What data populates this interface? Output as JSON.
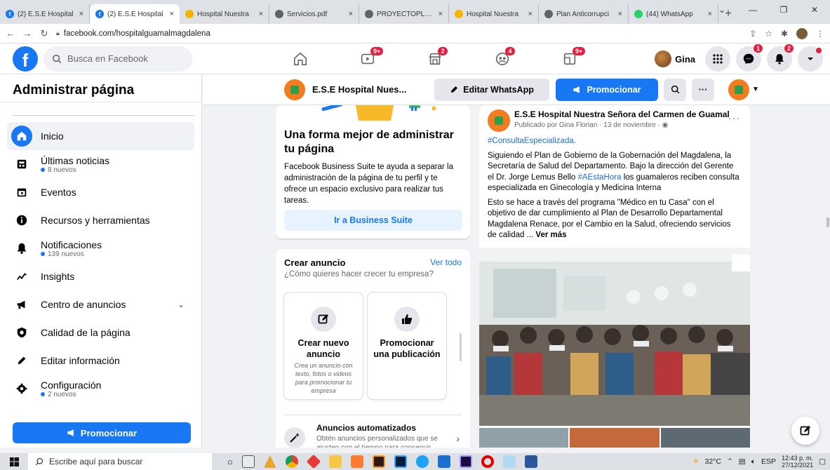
{
  "browser": {
    "tabs": [
      {
        "label": "(2) E.S.E Hospital",
        "color": "#1877f2",
        "active": false
      },
      {
        "label": "(2) E.S.E Hospital",
        "color": "#1877f2",
        "active": true
      },
      {
        "label": "Hospital Nuestra",
        "color": "#f4b400",
        "active": false
      },
      {
        "label": "Servicios.pdf",
        "color": "#5f6368",
        "active": false
      },
      {
        "label": "PROYECTOPLANE",
        "color": "#5f6368",
        "active": false
      },
      {
        "label": "Hospital Nuestra",
        "color": "#f4b400",
        "active": false
      },
      {
        "label": "Plan Anticorrupci",
        "color": "#5f6368",
        "active": false
      },
      {
        "label": "(44) WhatsApp",
        "color": "#25d366",
        "active": false
      }
    ],
    "close_glyph": "×",
    "newtab_glyph": "+",
    "url": "facebook.com/hospitalguamalmagdalena"
  },
  "fb_nav": {
    "logo_letter": "f",
    "search_placeholder": "Busca en Facebook",
    "icons": [
      {
        "name": "home-icon",
        "badge": ""
      },
      {
        "name": "watch-icon",
        "badge": "9+"
      },
      {
        "name": "marketplace-icon",
        "badge": "2"
      },
      {
        "name": "groups-icon",
        "badge": "4"
      },
      {
        "name": "gaming-icon",
        "badge": "9+"
      }
    ],
    "user_name": "Gina",
    "messenger_badge": "1",
    "notifications_badge": "2"
  },
  "sidebar": {
    "title": "Administrar página",
    "items": [
      {
        "label": "Inicio",
        "sub": "",
        "icon": "home-icon",
        "active": true
      },
      {
        "label": "Últimas noticias",
        "sub": "8 nuevos",
        "icon": "news-icon"
      },
      {
        "label": "Eventos",
        "sub": "",
        "icon": "calendar-icon"
      },
      {
        "label": "Recursos y herramientas",
        "sub": "",
        "icon": "info-icon"
      },
      {
        "label": "Notificaciones",
        "sub": "139 nuevos",
        "icon": "bell-icon"
      },
      {
        "label": "Insights",
        "sub": "",
        "icon": "insights-icon"
      },
      {
        "label": "Centro de anuncios",
        "sub": "",
        "icon": "megaphone-icon",
        "expandable": true
      },
      {
        "label": "Calidad de la página",
        "sub": "",
        "icon": "shield-icon"
      },
      {
        "label": "Editar información",
        "sub": "",
        "icon": "pencil-icon"
      },
      {
        "label": "Configuración",
        "sub": "2 nuevos",
        "icon": "gear-icon"
      }
    ],
    "promote_label": "Promocionar"
  },
  "page_bar": {
    "page_name": "E.S.E Hospital Nues...",
    "edit_whatsapp_label": "Editar WhatsApp",
    "promote_label": "Promocionar",
    "more_label": "···"
  },
  "business_suite": {
    "title": "Una forma mejor de administrar tu página",
    "description": "Facebook Business Suite te ayuda a separar la administración de la página de tu perfil y te ofrece un espacio exclusivo para realizar tus tareas.",
    "button_label": "Ir a Business Suite"
  },
  "create_ad": {
    "title": "Crear anuncio",
    "view_all": "Ver todo",
    "subtitle": "¿Cómo quieres hacer crecer tu empresa?",
    "options": [
      {
        "title": "Crear nuevo anuncio",
        "desc": "Crea un anuncio con texto, fotos o videos para promocionar tu empresa"
      },
      {
        "title": "Promocionar una publicación",
        "desc": ""
      }
    ],
    "auto_title": "Anuncios automatizados",
    "auto_desc": "Obtén anuncios personalizados que se ajusten con el tiempo para conseguir"
  },
  "post": {
    "author": "E.S.E Hospital Nuestra Señora del Carmen de Guamal",
    "meta": "Publicado por Gina Florian · 13 de noviembre ·",
    "hashtag": "#ConsultaEspecializada.",
    "para1_a": "Siguiendo el Plan de Gobierno de la Gobernación del Magdalena, la Secretaría de Salud del Departamento. Bajo la dirección del Gerente el Dr. Jorge Lemus Bello ",
    "para1_tag": "#AEstaHora",
    "para1_b": " los guamaleros reciben consulta especializada en Ginecología y Medicina Interna",
    "para2": "Esto se hace a través del programa \"Médico en tu Casa\" con el objetivo de dar cumplimiento al Plan de Desarrollo Departamental Magdalena Renace, por el Cambio en la Salud, ofreciendo servicios de calidad ... ",
    "see_more": "Ver más"
  },
  "taskbar": {
    "search_placeholder": "Escribe aquí para buscar",
    "weather": "32°C",
    "language": "ESP",
    "time": "12:43 p. m.",
    "date": "27/12/2021"
  },
  "colors": {
    "fb_blue": "#1877f2",
    "badge_red": "#e41e3f",
    "brand_orange": "#f47b20"
  }
}
